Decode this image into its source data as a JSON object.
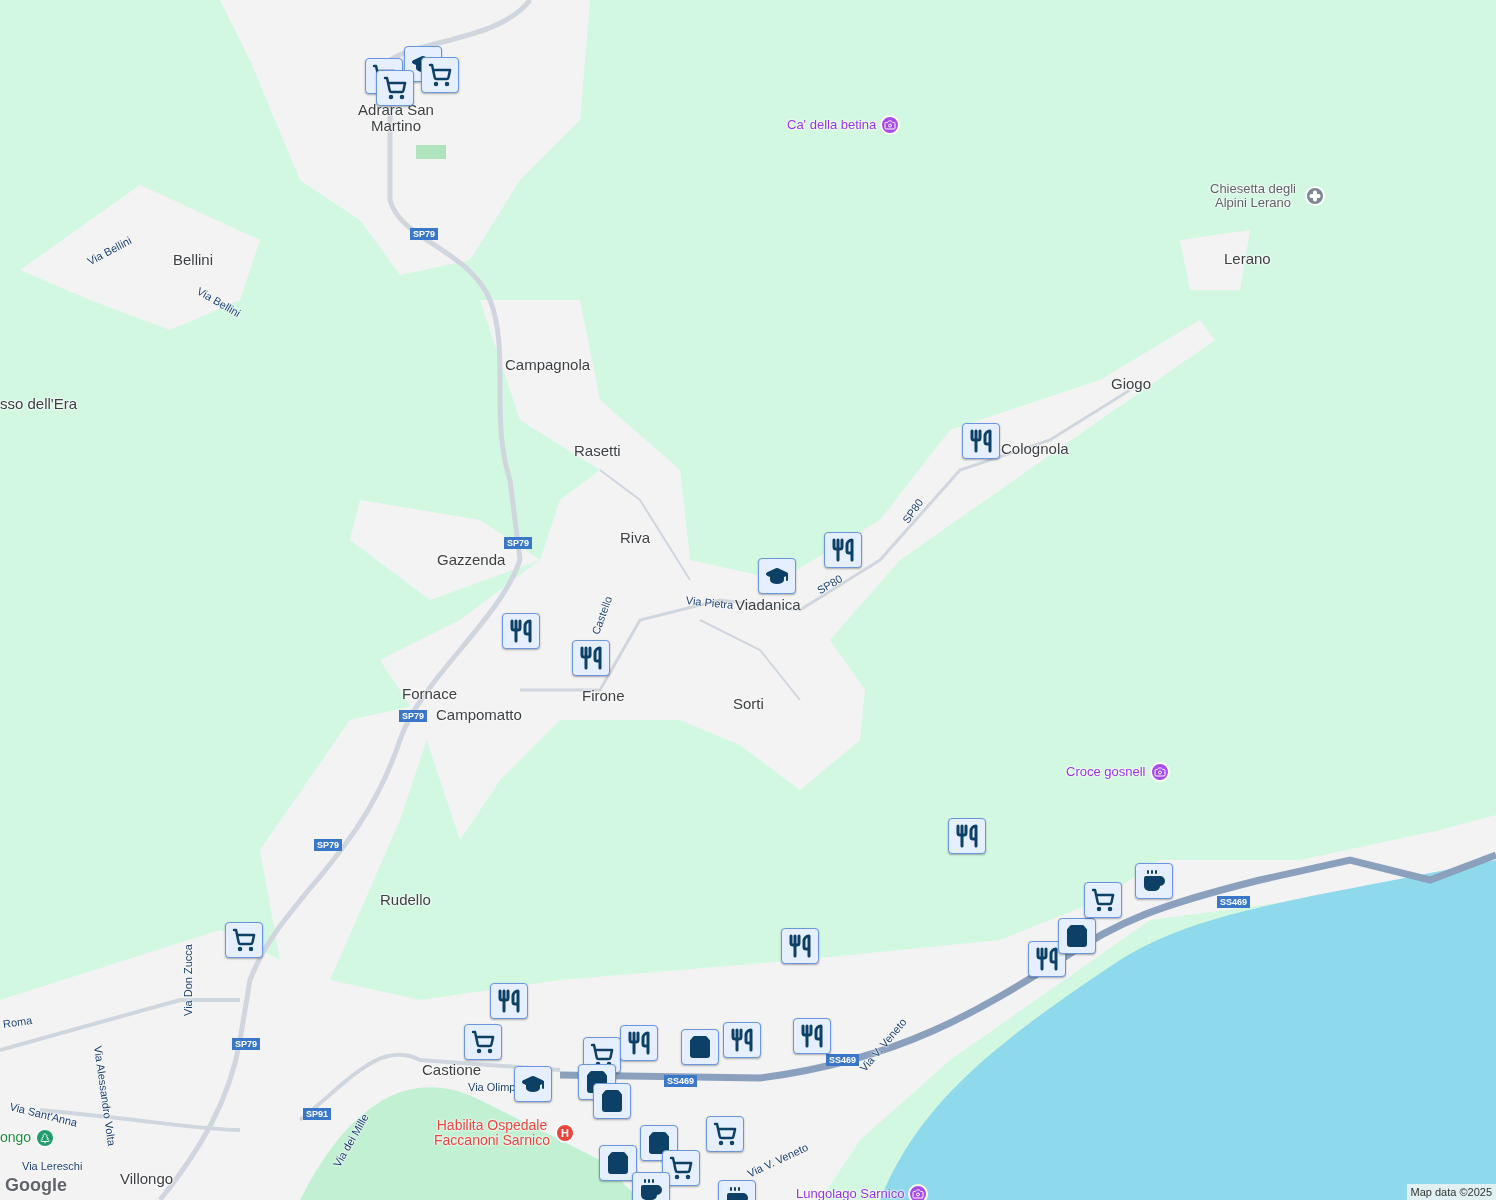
{
  "map": {
    "labels": [
      {
        "kind": "place",
        "text": "Adrara San Martino"
      },
      {
        "kind": "place",
        "text": "Bellini"
      },
      {
        "kind": "place",
        "text": "Campagnola"
      },
      {
        "kind": "place",
        "text": "sso dell'Era"
      },
      {
        "kind": "place",
        "text": "Rasetti"
      },
      {
        "kind": "place",
        "text": "Riva"
      },
      {
        "kind": "place",
        "text": "Gazzenda"
      },
      {
        "kind": "place",
        "text": "Viadanica"
      },
      {
        "kind": "place",
        "text": "Fornace"
      },
      {
        "kind": "place",
        "text": "Campomatto"
      },
      {
        "kind": "place",
        "text": "Firone"
      },
      {
        "kind": "place",
        "text": "Sorti"
      },
      {
        "kind": "place",
        "text": "Rudello"
      },
      {
        "kind": "place",
        "text": "Giogo"
      },
      {
        "kind": "place",
        "text": "Colognola"
      },
      {
        "kind": "place",
        "text": "Lerano"
      },
      {
        "kind": "place",
        "text": "Castione"
      },
      {
        "kind": "place",
        "text": "Villongo"
      },
      {
        "kind": "poi",
        "text": "Ca' della betina"
      },
      {
        "kind": "poi",
        "text": "Croce gosnell"
      },
      {
        "kind": "poi",
        "text": "Lungolago Sarnico"
      },
      {
        "kind": "church",
        "text": "Chiesetta degli Alpini Lerano"
      },
      {
        "kind": "park",
        "text": "ongo"
      },
      {
        "kind": "hospital",
        "text": "Habilita Ospedale Faccanoni Sarnico",
        "marker": "H"
      },
      {
        "kind": "road",
        "text": "Via Bellini"
      },
      {
        "kind": "road",
        "text": "Via Bellini"
      },
      {
        "kind": "road",
        "text": "Via Pietra"
      },
      {
        "kind": "road",
        "text": "Castello"
      },
      {
        "kind": "road",
        "text": "SP80"
      },
      {
        "kind": "road",
        "text": "SP80"
      },
      {
        "kind": "road",
        "text": "Via Don Zucca"
      },
      {
        "kind": "road",
        "text": "Via Alessandro Volta"
      },
      {
        "kind": "road",
        "text": "Via Sant'Anna"
      },
      {
        "kind": "road",
        "text": "Roma"
      },
      {
        "kind": "road",
        "text": "Via Lereschi"
      },
      {
        "kind": "road",
        "text": "Via Olimp"
      },
      {
        "kind": "road",
        "text": "Via dei Mille"
      },
      {
        "kind": "road",
        "text": "Via V. Veneto"
      },
      {
        "kind": "road",
        "text": "Via V. Veneto"
      },
      {
        "kind": "shield",
        "text": "SP79"
      },
      {
        "kind": "shield",
        "text": "SP79"
      },
      {
        "kind": "shield",
        "text": "SP79"
      },
      {
        "kind": "shield",
        "text": "SP79"
      },
      {
        "kind": "shield",
        "text": "SP79"
      },
      {
        "kind": "shield",
        "text": "SP91"
      },
      {
        "kind": "shield",
        "text": "SS469"
      },
      {
        "kind": "shield",
        "text": "SS469"
      },
      {
        "kind": "shield",
        "text": "SS469"
      }
    ],
    "attribution": "Map data ©2025",
    "logo": "Google"
  }
}
